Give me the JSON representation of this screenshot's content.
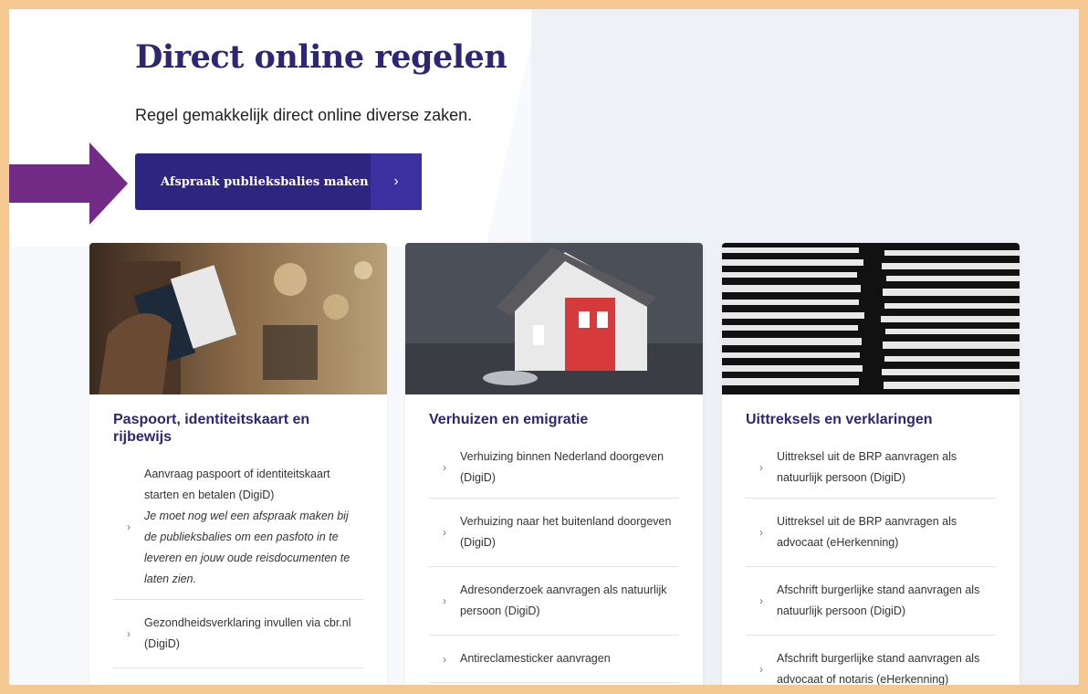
{
  "title": "Direct online regelen",
  "subtitle": "Regel gemakkelijk direct online diverse zaken.",
  "cta": {
    "label": "Afspraak publieksbalies maken",
    "icon": "chevron-right-icon"
  },
  "colors": {
    "brand": "#2e2580",
    "background": "#f5c892",
    "arrow": "#722b86"
  },
  "cards": [
    {
      "title": "Paspoort, identiteitskaart en rijbewijs",
      "items": [
        {
          "text": "Aanvraag paspoort of identiteitskaart starten en betalen (DigiD)",
          "note": "Je moet nog wel een afspraak maken bij de publieksbalies om een pasfoto in te leveren en jouw oude reisdocumenten te laten zien."
        },
        {
          "text": "Gezondheidsverklaring invullen via cbr.nl (DigiD)"
        }
      ]
    },
    {
      "title": "Verhuizen en emigratie",
      "items": [
        {
          "text": "Verhuizing binnen Nederland doorgeven (DigiD)"
        },
        {
          "text": "Verhuizing naar het buitenland doorgeven (DigiD)"
        },
        {
          "text": "Adresonderzoek aanvragen als natuurlijk persoon (DigiD)"
        },
        {
          "text": "Antireclamesticker aanvragen"
        }
      ]
    },
    {
      "title": "Uittreksels en verklaringen",
      "items": [
        {
          "text": "Uittreksel uit de BRP aanvragen als natuurlijk persoon (DigiD)"
        },
        {
          "text": "Uittreksel uit de BRP aanvragen als advocaat (eHerkenning)"
        },
        {
          "text": "Afschrift burgerlijke stand aanvragen als natuurlijk persoon (DigiD)"
        },
        {
          "text": "Afschrift burgerlijke stand aanvragen als advocaat of notaris (eHerkenning)"
        }
      ]
    }
  ]
}
